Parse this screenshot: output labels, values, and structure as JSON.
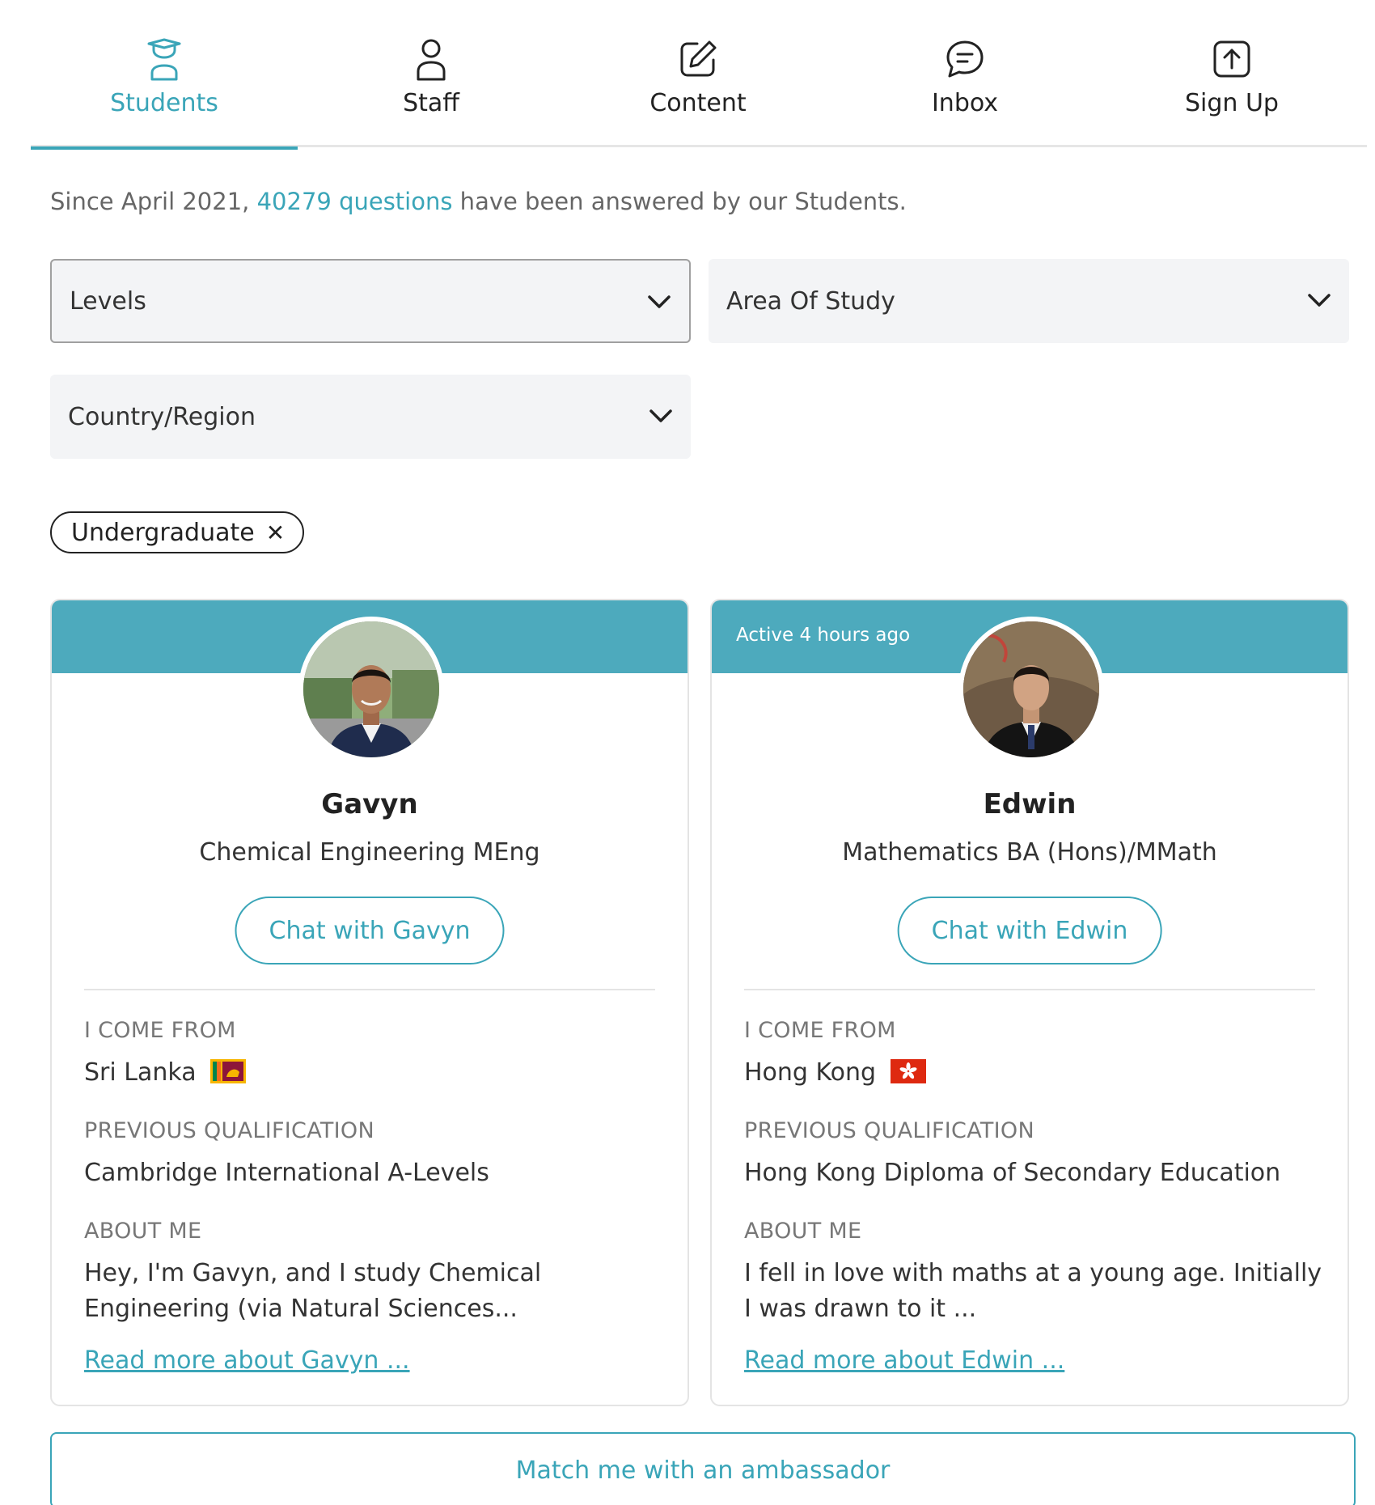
{
  "nav": {
    "tabs": [
      {
        "label": "Students",
        "icon": "graduate-icon",
        "active": true
      },
      {
        "label": "Staff",
        "icon": "person-icon"
      },
      {
        "label": "Content",
        "icon": "edit-icon"
      },
      {
        "label": "Inbox",
        "icon": "chat-bubble-icon"
      },
      {
        "label": "Sign Up",
        "icon": "upload-icon"
      }
    ],
    "accent_color": "#3aa5b8"
  },
  "summary": {
    "prefix": "Since April 2021, ",
    "count_link": "40279 questions",
    "suffix": " have been answered by our Students."
  },
  "filters": {
    "levels": "Levels",
    "area_of_study": "Area Of Study",
    "country_region": "Country/Region"
  },
  "active_filter": {
    "label": "Undergraduate",
    "remove": "✕"
  },
  "labels": {
    "come_from": "I COME FROM",
    "previous_qualification": "PREVIOUS QUALIFICATION",
    "about_me": "ABOUT ME"
  },
  "ambassadors": [
    {
      "status": "",
      "name": "Gavyn",
      "course": "Chemical Engineering MEng",
      "chat_label": "Chat with Gavyn",
      "country": "Sri Lanka",
      "flag": "sri-lanka-flag-icon",
      "qualification": "Cambridge International A-Levels",
      "about": "Hey, I'm Gavyn, and I study Chemical Engineering (via Natural Sciences...",
      "read_more": "Read more about Gavyn ..."
    },
    {
      "status": "Active 4 hours ago",
      "name": "Edwin",
      "course": "Mathematics BA (Hons)/MMath",
      "chat_label": "Chat with Edwin",
      "country": "Hong Kong",
      "flag": "hong-kong-flag-icon",
      "qualification": "Hong Kong Diploma of Secondary Education",
      "about": "I fell in love with maths at a young age. Initially I was drawn to it ...",
      "read_more": "Read more about Edwin ..."
    }
  ],
  "match_button": "Match me with an ambassador",
  "colors": {
    "accent": "#3aa5b8",
    "banner": "#4daabd",
    "select_bg": "#f3f4f6"
  }
}
